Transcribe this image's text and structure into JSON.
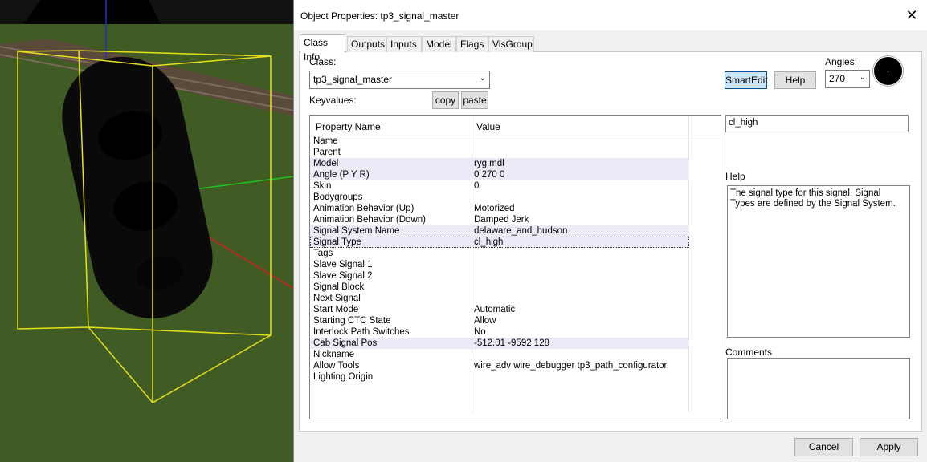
{
  "dialog": {
    "title": "Object Properties: tp3_signal_master",
    "close_label": "✕"
  },
  "tabs": [
    "Class Info",
    "Outputs",
    "Inputs",
    "Model",
    "Flags",
    "VisGroup"
  ],
  "class_section": {
    "class_label": "Class:",
    "class_value": "tp3_signal_master",
    "keyvalues_label": "Keyvalues:",
    "copy_label": "copy",
    "paste_label": "paste",
    "smartedit_label": "SmartEdit",
    "help_label": "Help",
    "angles_label": "Angles:",
    "angles_value": "270"
  },
  "grid": {
    "header_name": "Property Name",
    "header_value": "Value",
    "rows": [
      {
        "name": "Name",
        "value": ""
      },
      {
        "name": "Parent",
        "value": ""
      },
      {
        "name": "Model",
        "value": "ryg.mdl"
      },
      {
        "name": "Angle (P Y R)",
        "value": "0 270 0"
      },
      {
        "name": "Skin",
        "value": "0"
      },
      {
        "name": "Bodygroups",
        "value": ""
      },
      {
        "name": "Animation Behavior (Up)",
        "value": "Motorized"
      },
      {
        "name": "Animation Behavior (Down)",
        "value": "Damped Jerk"
      },
      {
        "name": "Signal System Name",
        "value": "delaware_and_hudson"
      },
      {
        "name": "Signal Type",
        "value": "cl_high"
      },
      {
        "name": "Tags",
        "value": ""
      },
      {
        "name": "Slave Signal 1",
        "value": ""
      },
      {
        "name": "Slave Signal 2",
        "value": ""
      },
      {
        "name": "Signal Block",
        "value": ""
      },
      {
        "name": "Next Signal",
        "value": ""
      },
      {
        "name": "Start Mode",
        "value": "Automatic"
      },
      {
        "name": "Starting CTC State",
        "value": "Allow"
      },
      {
        "name": "Interlock Path Switches",
        "value": "No"
      },
      {
        "name": "Cab Signal Pos",
        "value": "-512.01 -9592 128"
      },
      {
        "name": "Nickname",
        "value": ""
      },
      {
        "name": "Allow Tools",
        "value": "wire_adv wire_debugger tp3_path_configurator"
      },
      {
        "name": "Lighting Origin",
        "value": ""
      }
    ]
  },
  "side": {
    "value_edit": "cl_high",
    "help_label": "Help",
    "help_text": "The signal type for this signal. Signal Types are defined by the Signal System.",
    "comments_label": "Comments",
    "comments_text": ""
  },
  "footer": {
    "cancel_label": "Cancel",
    "apply_label": "Apply"
  },
  "colors": {
    "highlight_row": "#ebebf7",
    "smartedit_pressed": "#cce4f7"
  }
}
